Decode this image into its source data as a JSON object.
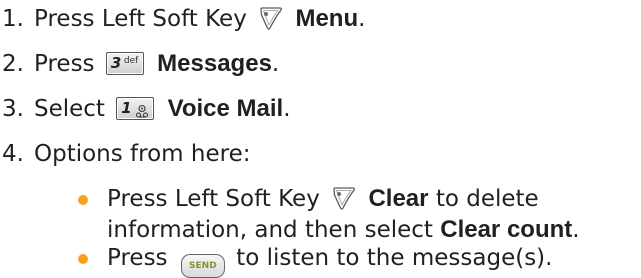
{
  "steps": [
    {
      "num": "1.",
      "pre": "Press Left Soft Key",
      "icon": "left-soft-key-icon",
      "bold": "Menu",
      "post": "."
    },
    {
      "num": "2.",
      "pre": "Press",
      "key_num": "3",
      "key_letters": "def",
      "bold": "Messages",
      "post": "."
    },
    {
      "num": "3.",
      "pre": "Select",
      "key_num": "1",
      "key_letters": "voicemail",
      "bold": "Voice Mail",
      "post": "."
    },
    {
      "num": "4.",
      "text": "Options from here:"
    }
  ],
  "options": [
    {
      "pre": "Press Left Soft Key",
      "icon": "left-soft-key-icon",
      "bold": "Clear",
      "post": "to delete",
      "line2_pre": "information, and then select",
      "line2_bold": "Clear count",
      "line2_post": "."
    },
    {
      "pre": "Press",
      "key_label": "SEND",
      "post": "to listen to the message(s)."
    }
  ],
  "colors": {
    "text": "#231f20",
    "bullet": "#f5a31a",
    "soft_key_icon": "#5a5a5a"
  }
}
